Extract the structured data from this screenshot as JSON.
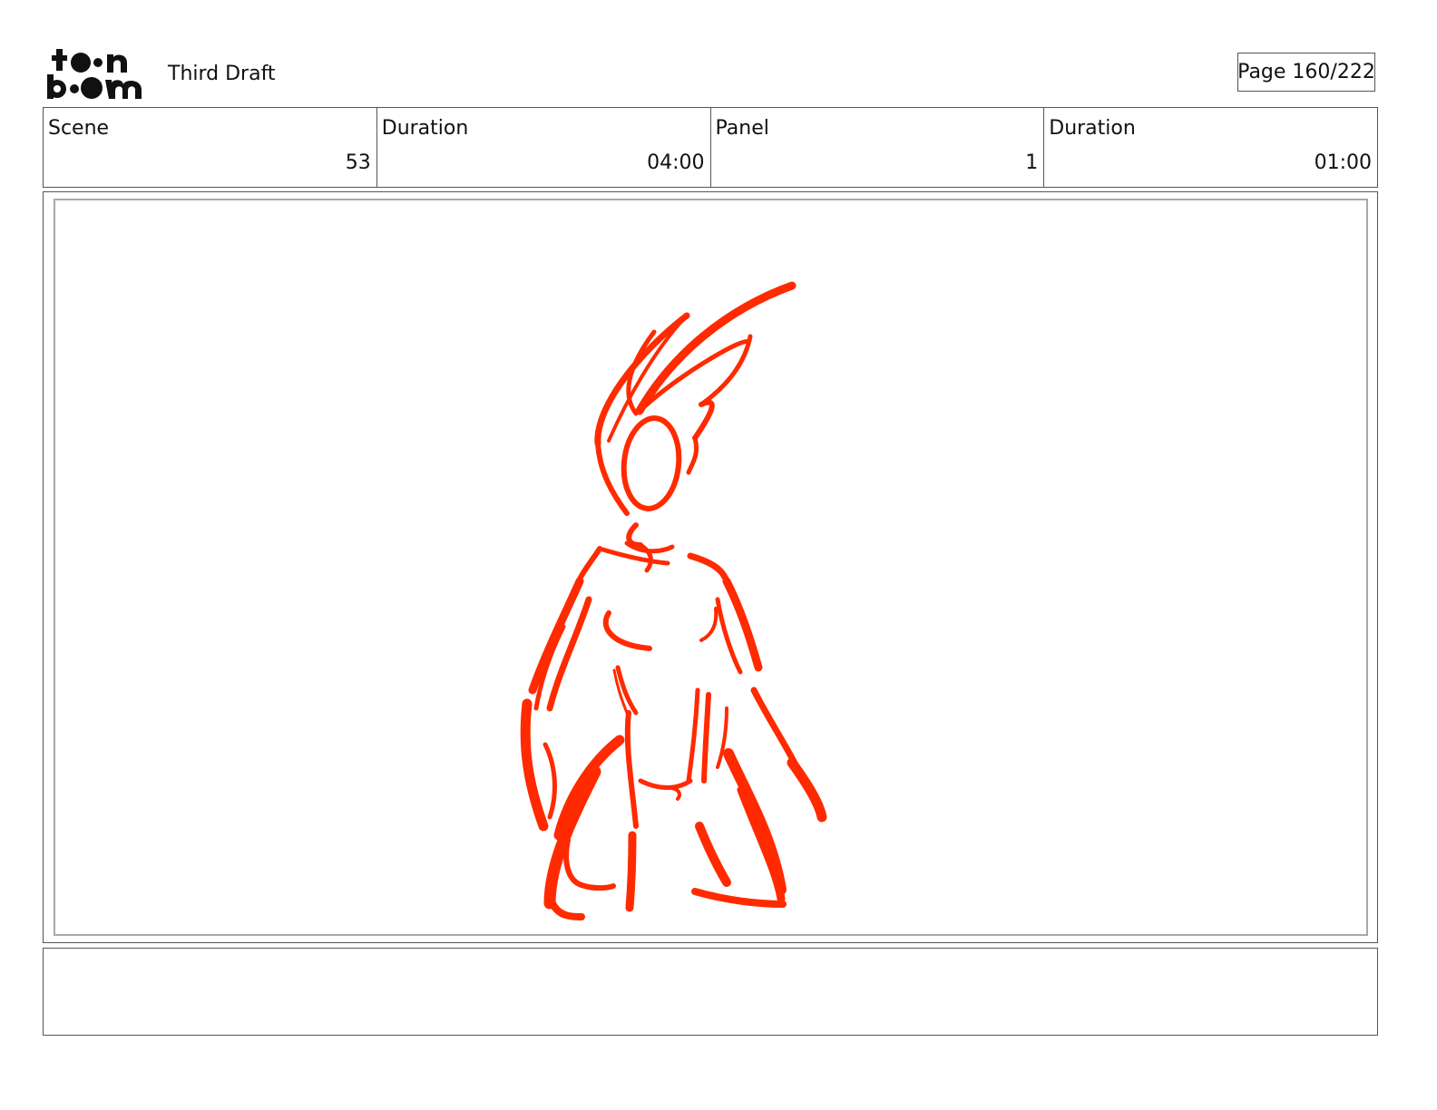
{
  "header": {
    "logo_text": "toon boom",
    "project_title": "Third Draft",
    "page_indicator": "Page 160/222"
  },
  "info": [
    {
      "label": "Scene",
      "value": "53"
    },
    {
      "label": "Duration",
      "value": "04:00"
    },
    {
      "label": "Panel",
      "value": "1"
    },
    {
      "label": "Duration",
      "value": "01:00"
    }
  ],
  "panel": {
    "sketch_color": "#ff2a00"
  },
  "notes": {
    "text": ""
  }
}
